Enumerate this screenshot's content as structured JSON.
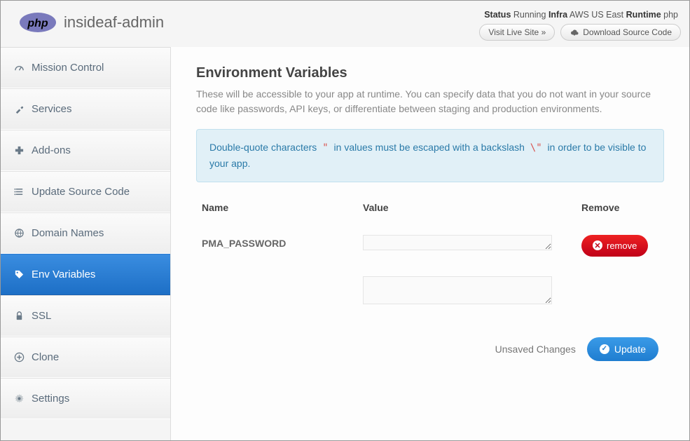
{
  "header": {
    "app_name": "insideaf-admin",
    "status_label": "Status",
    "status_value": "Running",
    "infra_label": "Infra",
    "infra_value": "AWS US East",
    "runtime_label": "Runtime",
    "runtime_value": "php",
    "visit_button": "Visit Live Site »",
    "download_button": "Download Source Code"
  },
  "sidebar": {
    "items": [
      {
        "label": "Mission Control"
      },
      {
        "label": "Services"
      },
      {
        "label": "Add-ons"
      },
      {
        "label": "Update Source Code"
      },
      {
        "label": "Domain Names"
      },
      {
        "label": "Env Variables"
      },
      {
        "label": "SSL"
      },
      {
        "label": "Clone"
      },
      {
        "label": "Settings"
      }
    ]
  },
  "page": {
    "title": "Environment Variables",
    "description": "These will be accessible to your app at runtime. You can specify data that you do not want in your source code like passwords, API keys, or differentiate between staging and production environments.",
    "alert_pre": "Double-quote characters ",
    "alert_quote": "\"",
    "alert_mid": " in values must be escaped with a backslash ",
    "alert_esc": "\\\"",
    "alert_post": " in order to be visible to your app."
  },
  "table": {
    "headers": {
      "name": "Name",
      "value": "Value",
      "remove": "Remove"
    },
    "rows": [
      {
        "name": "PMA_PASSWORD",
        "value": ""
      }
    ],
    "remove_label": "remove"
  },
  "footer": {
    "unsaved": "Unsaved Changes",
    "update": "Update"
  }
}
